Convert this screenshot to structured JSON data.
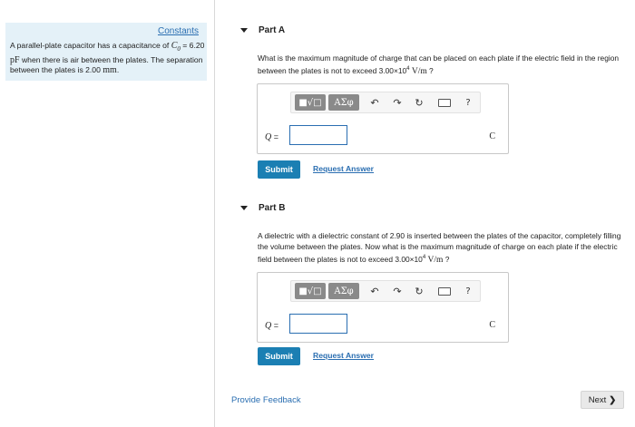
{
  "left": {
    "constants_link": "Constants",
    "problem": {
      "intro": "A parallel-plate capacitor has a capacitance of",
      "c_symbol": "C",
      "c_sub": "0",
      "eq_value": "= 6.20",
      "c_unit": "pF",
      "mid": "when there is air between the plates. The separation between the plates is",
      "separation": "2.00",
      "sep_unit": "mm",
      "end": "."
    }
  },
  "part_a": {
    "title": "Part A",
    "question_pre": "What is the maximum magnitude of charge that can be placed on each plate if the electric field in the region between the plates is not to exceed",
    "field_value": "3.00×10",
    "field_exp": "4",
    "field_unit": "V/m",
    "question_post": "?",
    "answer_label": "Q",
    "answer_eq": "=",
    "answer_value": "",
    "unit": "C",
    "submit": "Submit",
    "request": "Request Answer"
  },
  "part_b": {
    "title": "Part B",
    "question_pre": "A dielectric with a dielectric constant of 2.90 is inserted between the plates of the capacitor, completely filling the volume between the plates. Now what is the maximum magnitude of charge on each plate if the electric field between the plates is not to exceed",
    "field_value": "3.00×10",
    "field_exp": "4",
    "field_unit": "V/m",
    "question_post": "?",
    "answer_label": "Q",
    "answer_eq": "=",
    "answer_value": "",
    "unit": "C",
    "submit": "Submit",
    "request": "Request Answer"
  },
  "toolbar": {
    "templates": "■√□",
    "greek": "ΑΣφ",
    "undo": "↶",
    "redo": "↷",
    "reset": "↻",
    "help": "?"
  },
  "footer": {
    "feedback": "Provide Feedback",
    "next": "Next",
    "next_chevron": "❯"
  }
}
